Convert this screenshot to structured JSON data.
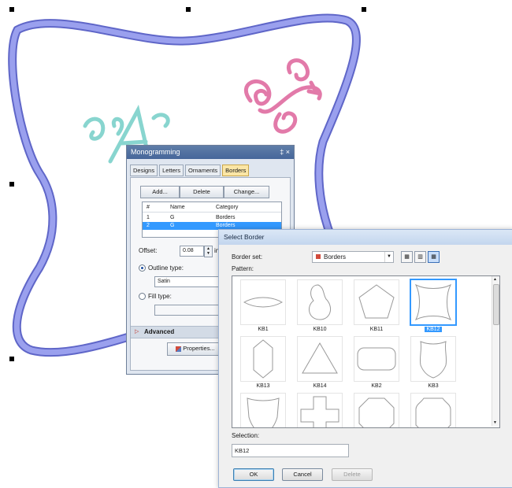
{
  "colors": {
    "frame": "#8f95e6",
    "swirl": "#e27aa9",
    "mono_letters": "#88d5cf",
    "selection": "#3399ff",
    "active_tab": "#fbe6a6"
  },
  "monogramming": {
    "title": "Monogramming",
    "title_controls": "‡ ×",
    "tabs": [
      "Designs",
      "Letters",
      "Ornaments",
      "Borders"
    ],
    "active_tab": "Borders",
    "buttons": {
      "add": "Add...",
      "delete": "Delete",
      "change": "Change..."
    },
    "list_headers": [
      "#",
      "Name",
      "Category"
    ],
    "list_rows": [
      {
        "num": "1",
        "name": "G",
        "category": "Borders"
      },
      {
        "num": "2",
        "name": "G",
        "category": "Borders"
      }
    ],
    "offset_label": "Offset:",
    "offset_value": "0.08",
    "offset_unit": "in",
    "outline_type_label": "Outline type:",
    "outline_type_value": "Satin",
    "fill_type_label": "Fill type:",
    "advanced_label": "Advanced",
    "properties_label": "Properties..."
  },
  "select_border": {
    "title": "Select Border",
    "border_set_label": "Border set:",
    "border_set_value": "Borders",
    "pattern_label": "Pattern:",
    "patterns": [
      "KB1",
      "KB10",
      "KB11",
      "KB12",
      "KB13",
      "KB14",
      "KB2",
      "KB3"
    ],
    "selected_pattern": "KB12",
    "selection_label": "Selection:",
    "selection_value": "KB12",
    "ok_label": "OK",
    "cancel_label": "Cancel",
    "delete_label": "Delete"
  }
}
